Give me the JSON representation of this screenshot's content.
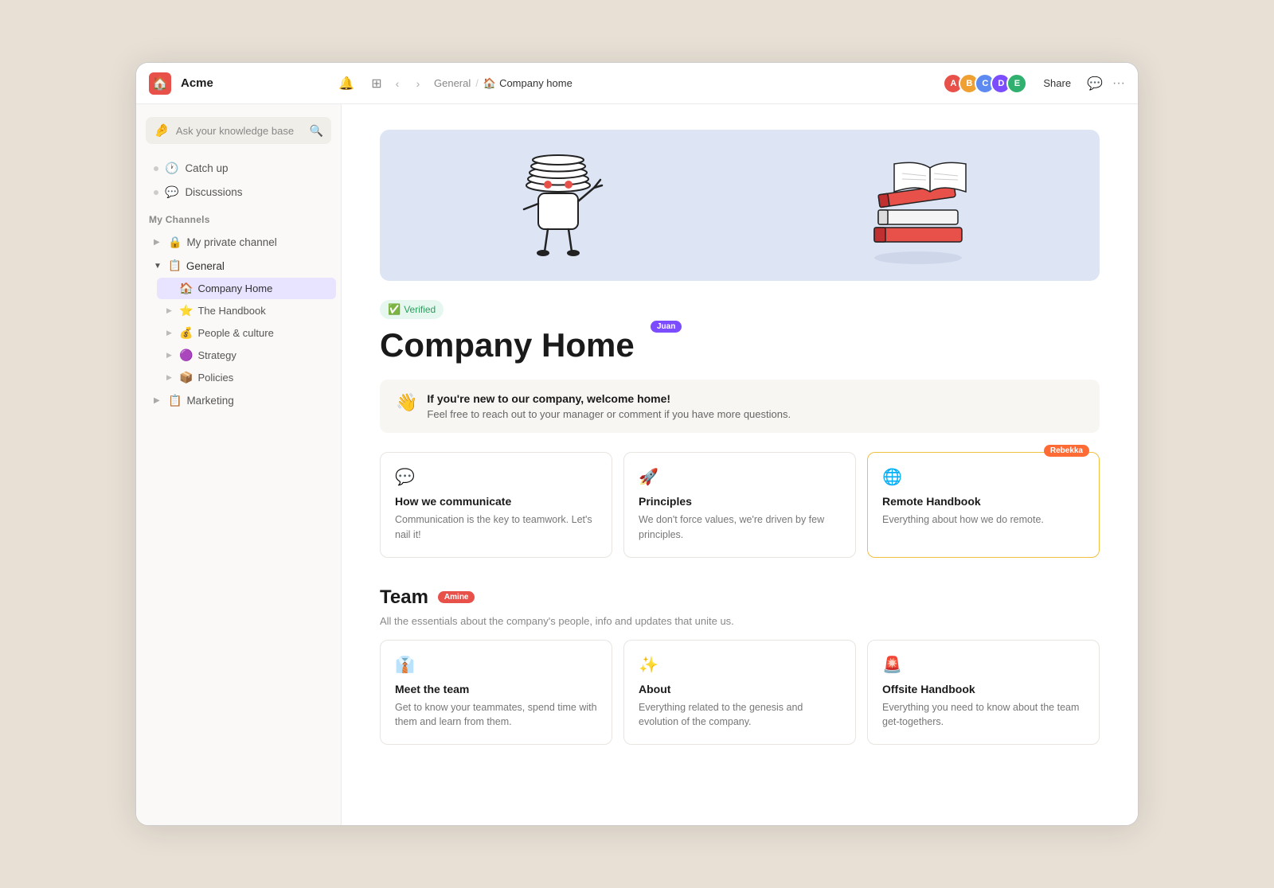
{
  "app": {
    "name": "Acme",
    "logo": "🏠"
  },
  "topbar": {
    "breadcrumb_parent": "General",
    "breadcrumb_current": "Company home",
    "share_label": "Share",
    "avatars": [
      "#e8504a",
      "#f0a030",
      "#5c8af0",
      "#7c4dff",
      "#30b06e"
    ],
    "avatar_initials": [
      "A",
      "B",
      "C",
      "D",
      "E"
    ]
  },
  "sidebar": {
    "search_placeholder": "Ask your knowledge base",
    "quick_items": [
      {
        "label": "Catch up",
        "icon": "🕐"
      },
      {
        "label": "Discussions",
        "icon": "💬"
      }
    ],
    "my_channels_title": "My Channels",
    "channels": [
      {
        "label": "My private channel",
        "icon": "🔒",
        "expanded": false
      },
      {
        "label": "General",
        "icon": "📋",
        "expanded": true,
        "children": [
          {
            "label": "Company Home",
            "icon": "🏠",
            "active": true
          },
          {
            "label": "The Handbook",
            "icon": "⭐"
          },
          {
            "label": "People & culture",
            "icon": "💰"
          },
          {
            "label": "Strategy",
            "icon": "🟣"
          },
          {
            "label": "Policies",
            "icon": "📦"
          }
        ]
      },
      {
        "label": "Marketing",
        "icon": "📋",
        "expanded": false
      }
    ]
  },
  "content": {
    "verified_label": "Verified",
    "page_title": "Company Home",
    "cursor_juan": "Juan",
    "cursor_rebekka": "Rebekka",
    "cursor_amine": "Amine",
    "welcome": {
      "emoji": "👋",
      "title": "If you're new to our company, welcome home!",
      "text": "Feel free to reach out to your manager or comment if you have more questions."
    },
    "cards": [
      {
        "icon": "💬",
        "title": "How we communicate",
        "desc": "Communication is the key to teamwork. Let's nail it!"
      },
      {
        "icon": "🚀",
        "title": "Principles",
        "desc": "We don't force values, we're driven by few principles."
      },
      {
        "icon": "🌐",
        "title": "Remote Handbook",
        "desc": "Everything about how we do remote.",
        "highlighted": true
      }
    ],
    "team_section": {
      "title": "Team",
      "desc": "All the essentials about the company's people, info and updates that unite us.",
      "cards": [
        {
          "icon": "👔",
          "title": "Meet the team",
          "desc": "Get to know your teammates, spend time with them and learn from them."
        },
        {
          "icon": "✨",
          "title": "About",
          "desc": "Everything related to the genesis and evolution of the company."
        },
        {
          "icon": "🚨",
          "title": "Offsite Handbook",
          "desc": "Everything you need to know about the team get-togethers."
        }
      ]
    }
  }
}
